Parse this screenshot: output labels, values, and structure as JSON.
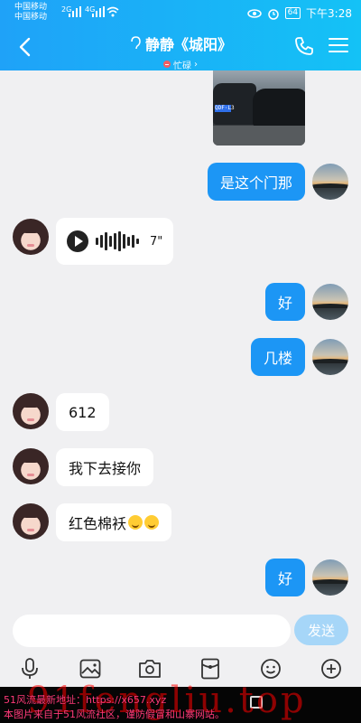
{
  "status_bar": {
    "carrier1": "中国移动",
    "carrier2": "中国移动",
    "sig1": "2G",
    "sig2": "4G",
    "battery": "64",
    "time": "下午3:28"
  },
  "header": {
    "title": "静静《城阳》",
    "status_text": "忙碌",
    "status_chevron": "›",
    "colors": {
      "gradient_start": "#1fa2f8",
      "gradient_end": "#14c2f6"
    }
  },
  "chat": {
    "photo_plate": "QDF·L3",
    "messages": [
      {
        "side": "right",
        "type": "text",
        "text": "是这个门那"
      },
      {
        "side": "left",
        "type": "voice",
        "duration": "7\""
      },
      {
        "side": "right",
        "type": "text",
        "text": "好"
      },
      {
        "side": "right",
        "type": "text",
        "text": "几楼"
      },
      {
        "side": "left",
        "type": "text",
        "text": "612"
      },
      {
        "side": "left",
        "type": "text",
        "text": "我下去接你"
      },
      {
        "side": "left",
        "type": "text",
        "text": "红色棉袄",
        "emoji": [
          "sleepy-face",
          "sleepy-face"
        ]
      },
      {
        "side": "right",
        "type": "text",
        "text": "好"
      }
    ]
  },
  "input": {
    "value": "",
    "send_label": "发送"
  },
  "toolbar": {
    "icons": [
      "microphone-icon",
      "image-icon",
      "camera-icon",
      "red-packet-icon",
      "emoji-icon",
      "plus-icon"
    ]
  },
  "watermark": {
    "line1": "51风流最新地址：https://x657.xyz",
    "line2": "本图片来自于51风流社区，谨防假冒和山寨网站。",
    "big": "91fengliu.top"
  }
}
